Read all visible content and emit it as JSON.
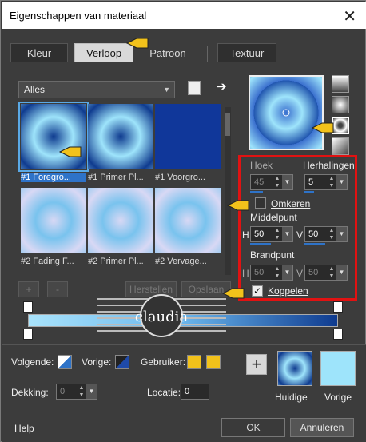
{
  "window": {
    "title": "Eigenschappen van materiaal",
    "close_glyph": "✕"
  },
  "tabs": [
    {
      "label": "Kleur"
    },
    {
      "label": "Verloop",
      "active": true
    },
    {
      "label": "Patroon"
    },
    {
      "label": "Textuur"
    }
  ],
  "library": {
    "filter_value": "Alles",
    "book_icon": "book-icon",
    "arrow_icon": "arrow-right-icon",
    "tiles": [
      {
        "label": "#1 Foregro...",
        "style": "circles-dark",
        "selected": true
      },
      {
        "label": "#1 Primer Pl...",
        "style": "circles-dark"
      },
      {
        "label": "#1 Voorgro...",
        "style": "solid-navy"
      },
      {
        "label": "#2 Fading F...",
        "style": "circles-light"
      },
      {
        "label": "#2 Primer Pl...",
        "style": "circles-light"
      },
      {
        "label": "#2 Vervage...",
        "style": "circles-light"
      }
    ]
  },
  "stop_buttons": {
    "add": "+",
    "remove": "-",
    "reset": "Herstellen",
    "save": "Opslaan"
  },
  "watermark": {
    "text": "claudia"
  },
  "settings": {
    "hoek_label": "Hoek",
    "hoek_value": "45",
    "herhalingen_label": "Herhalingen",
    "herhalingen_value": "5",
    "omkeren_label": "Omkeren",
    "omkeren_checked": false,
    "middelpunt_label": "Middelpunt",
    "middel_h_label": "H",
    "middel_h_value": "50",
    "middel_v_label": "V",
    "middel_v_value": "50",
    "brandpunt_label": "Brandpunt",
    "brand_h_label": "H",
    "brand_h_value": "50",
    "brand_v_label": "V",
    "brand_v_value": "50",
    "koppelen_label": "Koppelen",
    "koppelen_checked": true,
    "check_glyph": "✓"
  },
  "gradient_bar": {
    "colors": [
      "#a9e3fb",
      "#6ab6ec",
      "#0f3b8f"
    ]
  },
  "bottom": {
    "volgende_label": "Volgende:",
    "vorige_label": "Vorige:",
    "gebruiker_label": "Gebruiker:",
    "gebruiker_color": "#f2c21b",
    "dekking_label": "Dekking:",
    "dekking_value": "0",
    "locatie_label": "Locatie:",
    "locatie_value": "0",
    "add_glyph": "+",
    "huidige_label": "Huidige",
    "vorige_swatch_label": "Vorige",
    "vorige_swatch_color": "#9ee4fb"
  },
  "footer": {
    "help": "Help",
    "ok": "OK",
    "cancel": "Annuleren"
  },
  "colors": {
    "accent": "#2e73c8",
    "highlight_box": "#e11212",
    "pointer": "#f2c21b"
  }
}
